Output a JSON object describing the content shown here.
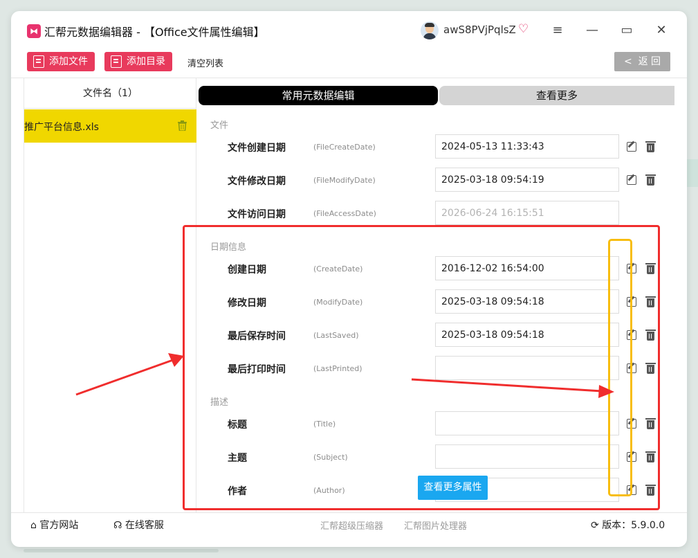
{
  "window": {
    "title": "汇帮元数据编辑器 - 【Office文件属性编辑】",
    "username": "awS8PVjPqlsZ"
  },
  "toolbar": {
    "add_file": "添加文件",
    "add_dir": "添加目录",
    "clear_list": "清空列表",
    "back": "返 回"
  },
  "file_list": {
    "header": "文件名（1）",
    "items": [
      {
        "name": "推广平台信息.xls"
      }
    ]
  },
  "tabs": {
    "common": "常用元数据编辑",
    "more": "查看更多"
  },
  "sections": {
    "file": {
      "title": "文件",
      "fields": [
        {
          "label": "文件创建日期",
          "key": "(FileCreateDate)",
          "value": "2024-05-13 11:33:43"
        },
        {
          "label": "文件修改日期",
          "key": "(FileModifyDate)",
          "value": "2025-03-18 09:54:19"
        },
        {
          "label": "文件访问日期",
          "key": "(FileAccessDate)",
          "value": "2026-06-24 16:15:51"
        }
      ]
    },
    "date": {
      "title": "日期信息",
      "fields": [
        {
          "label": "创建日期",
          "key": "(CreateDate)",
          "value": "2016-12-02 16:54:00"
        },
        {
          "label": "修改日期",
          "key": "(ModifyDate)",
          "value": "2025-03-18 09:54:18"
        },
        {
          "label": "最后保存时间",
          "key": "(LastSaved)",
          "value": "2025-03-18 09:54:18"
        },
        {
          "label": "最后打印时间",
          "key": "(LastPrinted)",
          "value": ""
        }
      ]
    },
    "desc": {
      "title": "描述",
      "fields": [
        {
          "label": "标题",
          "key": "(Title)",
          "value": ""
        },
        {
          "label": "主题",
          "key": "(Subject)",
          "value": ""
        },
        {
          "label": "作者",
          "key": "(Author)",
          "value": ""
        }
      ]
    }
  },
  "more_props_button": "查看更多属性",
  "statusbar": {
    "website": "官方网站",
    "service": "在线客服",
    "link1": "汇帮超级压缩器",
    "link2": "汇帮图片处理器",
    "version": "版本：5.9.0.0"
  },
  "colors": {
    "accent_red": "#e83a5c",
    "highlight_yellow": "#f0d700",
    "annotation_red": "#f02d2d",
    "annotation_yellow": "#f7bd10",
    "button_blue": "#1aa7f0"
  }
}
